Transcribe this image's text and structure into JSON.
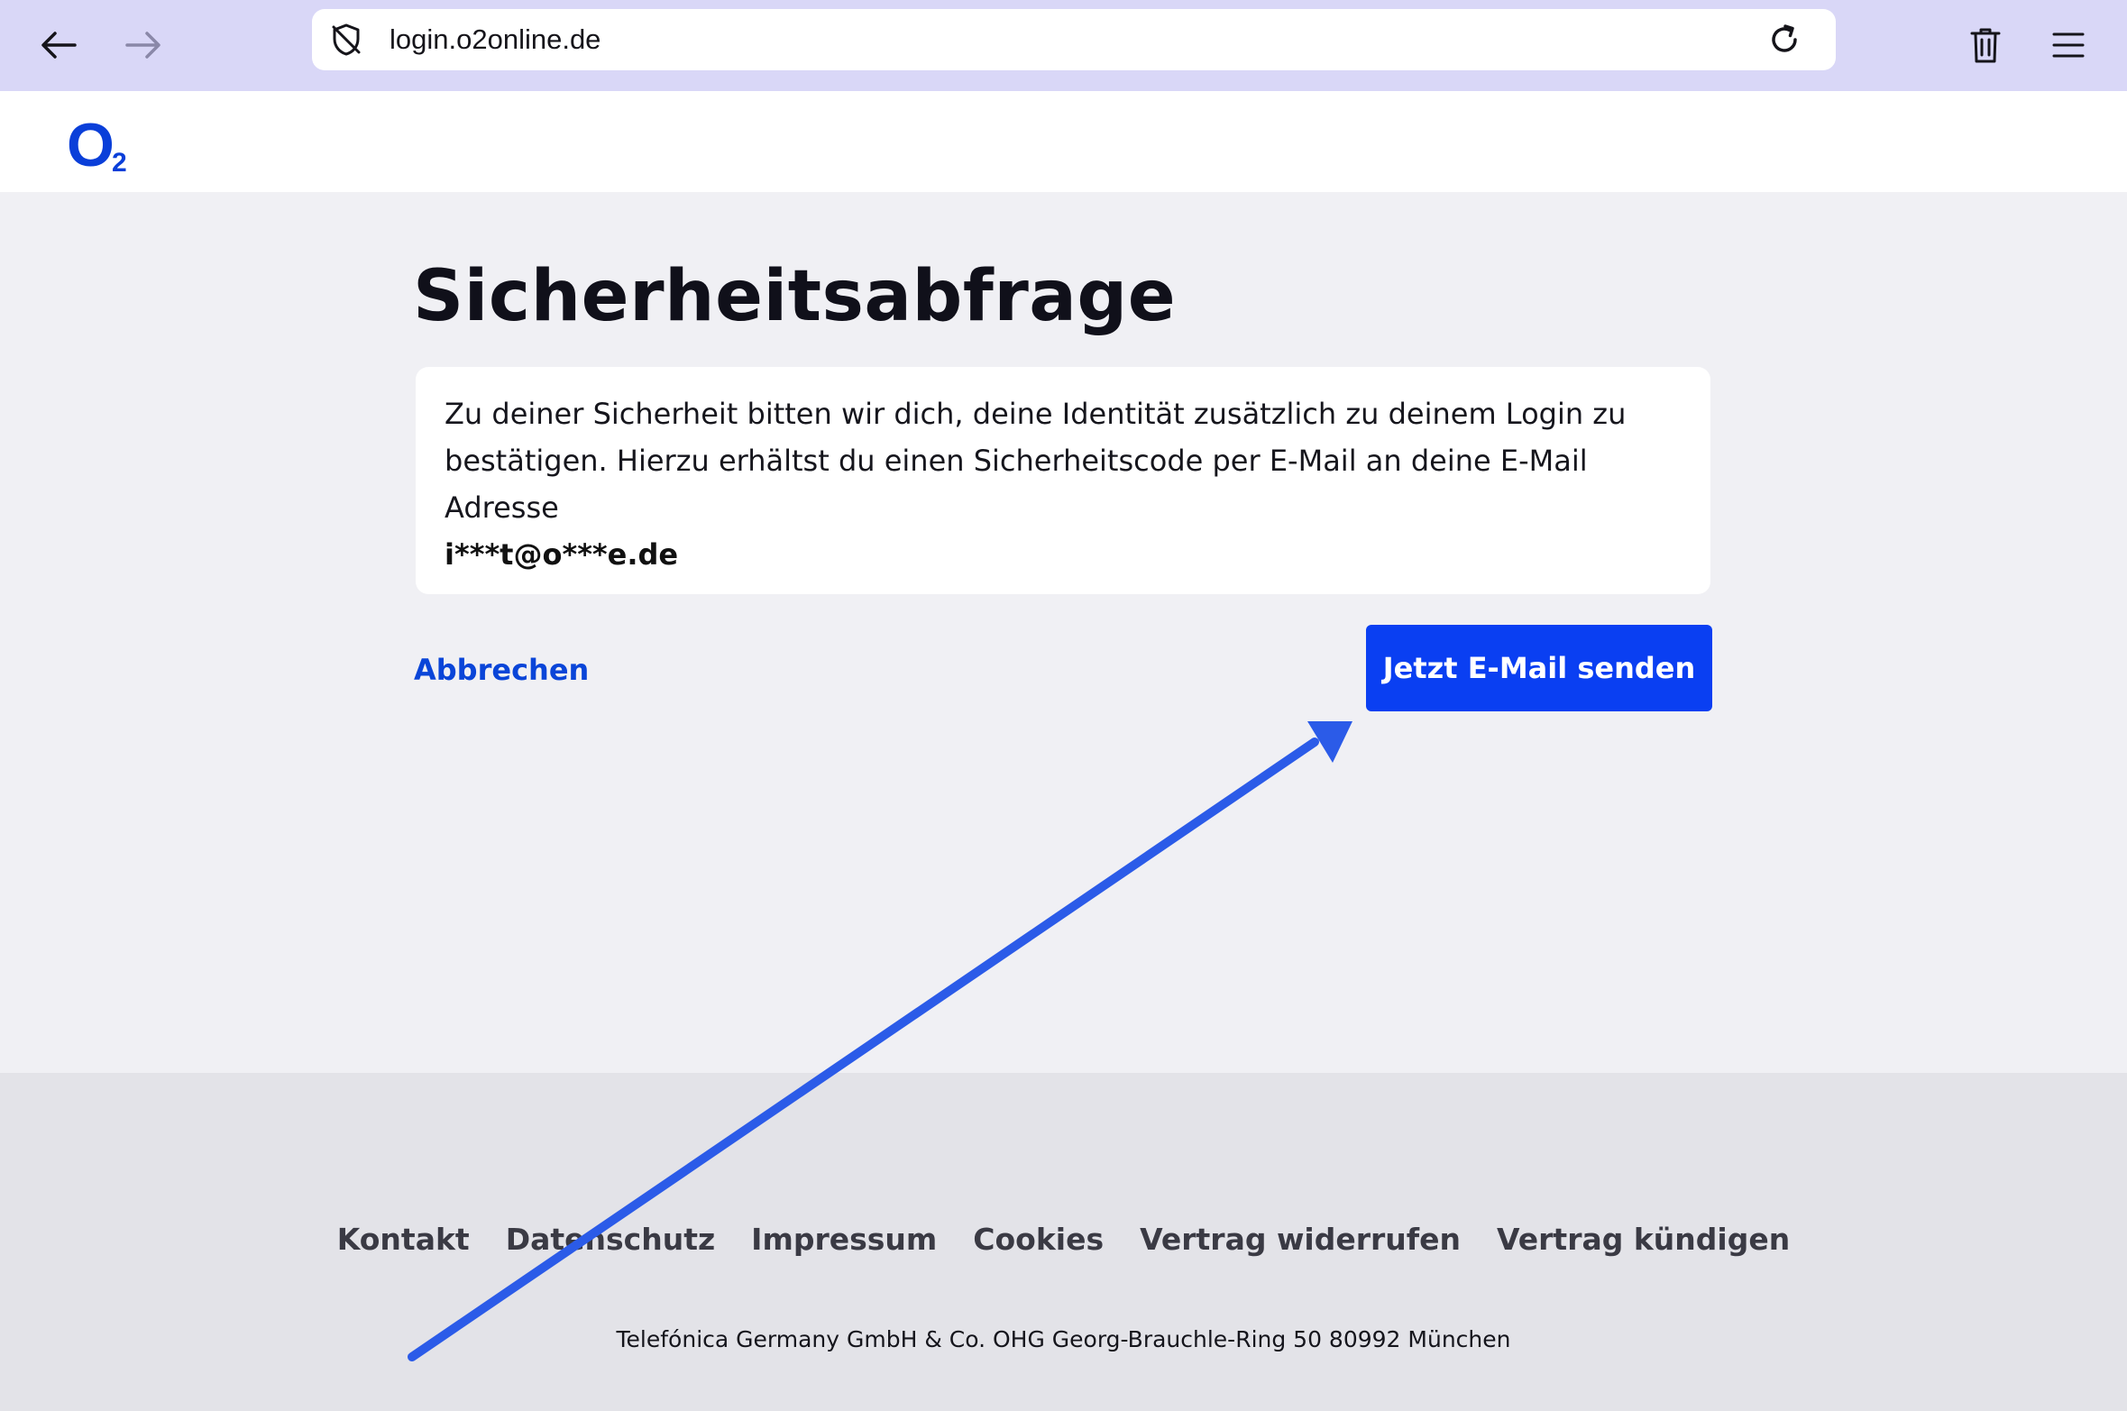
{
  "browser": {
    "url": "login.o2online.de",
    "icons": {
      "back": "arrow-left-icon",
      "forward": "arrow-right-icon",
      "tracking": "shield-icon",
      "reload": "reload-icon",
      "delete": "trash-icon",
      "menu": "hamburger-menu-icon"
    }
  },
  "header": {
    "logo_o": "O",
    "logo_2": "2"
  },
  "page": {
    "title": "Sicherheitsabfrage",
    "message": "Zu deiner Sicherheit bitten wir dich, deine Identität zusätzlich zu deinem Login zu bestätigen. Hierzu erhältst du einen Sicherheitscode per E-Mail an deine E-Mail Adresse",
    "email": "i***t@o***e.de",
    "cancel_label": "Abbrechen",
    "send_label": "Jetzt E-Mail senden"
  },
  "footer": {
    "links": [
      "Kontakt",
      "Datenschutz",
      "Impressum",
      "Cookies",
      "Vertrag widerrufen",
      "Vertrag kündigen"
    ],
    "company": "Telefónica Germany GmbH & Co. OHG Georg-Brauchle-Ring 50 80992 München"
  },
  "colors": {
    "browser_bar": "#d9d7f7",
    "brand_blue": "#0a3ff2",
    "link_blue": "#0a45d8",
    "annotation_arrow": "#2b5be8"
  }
}
